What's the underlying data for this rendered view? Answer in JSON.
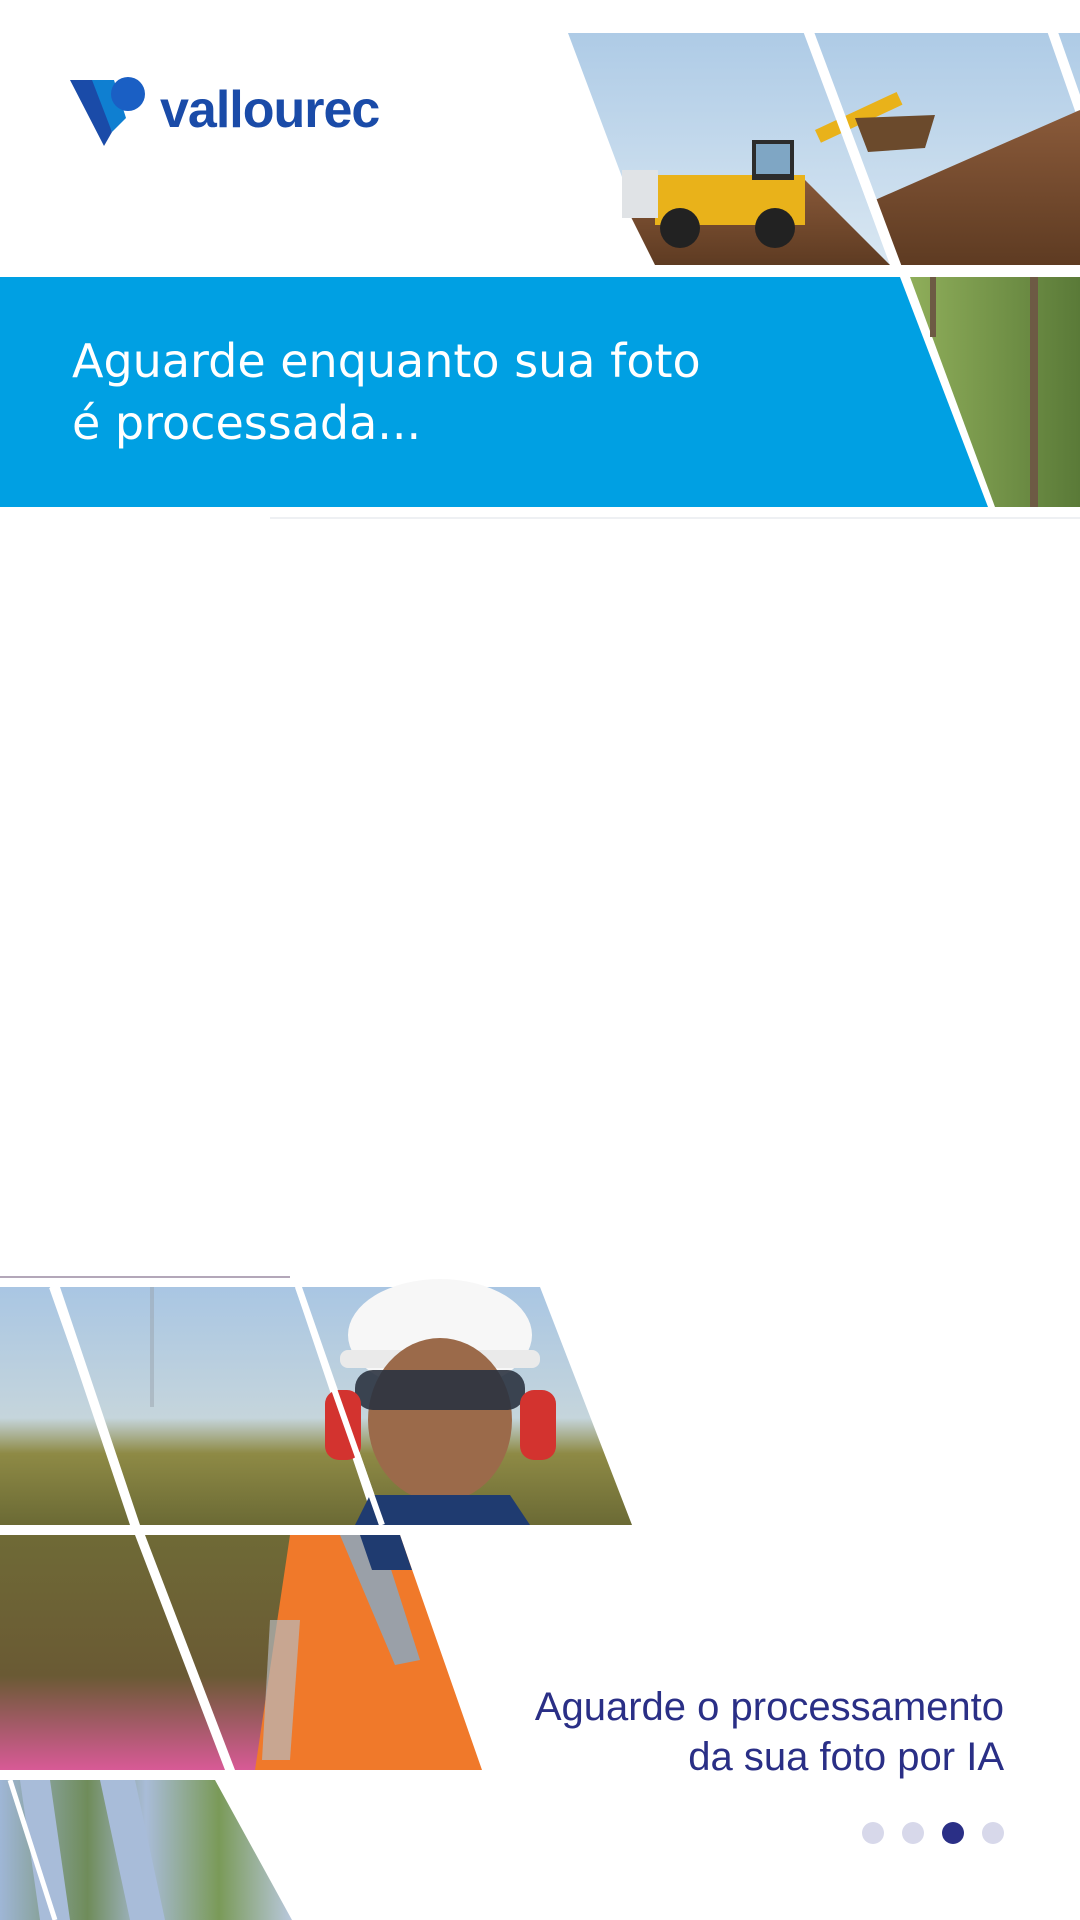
{
  "brand": {
    "name": "vallourec",
    "logo_icon": "vallourec-v-logo-icon",
    "color": "#1a4ba8"
  },
  "banner": {
    "line1": "Aguarde enquanto sua foto",
    "line2": "é processada...",
    "background": "#00a0e3"
  },
  "footer": {
    "line1": "Aguarde o processamento",
    "line2": "da sua foto por IA",
    "color": "#2a2f86"
  },
  "pagination": {
    "total": 4,
    "active_index": 2,
    "active_color": "#2a2f86",
    "inactive_color": "#d7d8ea"
  },
  "photos": [
    "construction-loader-photo",
    "forest-trees-photo",
    "worker-hardhat-portrait-photo",
    "worker-orange-jacket-photo",
    "solar-panels-field-photo"
  ]
}
